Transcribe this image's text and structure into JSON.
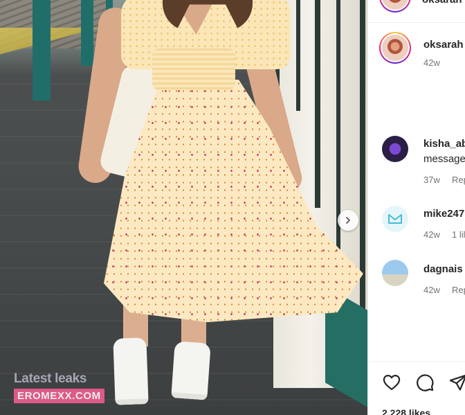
{
  "post_image": {
    "alt": "",
    "next_button_icon": "chevron-right-icon"
  },
  "watermark": {
    "line1": "Latest leaks",
    "line2": "EROMEXX.COM",
    "accent": "#ef5d8f"
  },
  "header": {
    "username": "oksarah"
  },
  "caption": {
    "username": "oksarah",
    "time": "42w"
  },
  "comments": [
    {
      "username": "kisha_ab",
      "text": "message",
      "time": "37w",
      "reply": "Rep"
    },
    {
      "username": "mike247",
      "time": "42w",
      "likes": "1 lil"
    },
    {
      "username": "dagnais",
      "time": "42w",
      "reply": "Rep"
    }
  ],
  "actions": {
    "like_icon": "heart-icon",
    "comment_icon": "comment-icon",
    "share_icon": "send-icon"
  },
  "likes_label": "2,228 likes",
  "colors": {
    "text": "#262626",
    "muted": "#737373",
    "story_ring": [
      "#f9ce34",
      "#ee2a7b",
      "#6228d7"
    ]
  }
}
